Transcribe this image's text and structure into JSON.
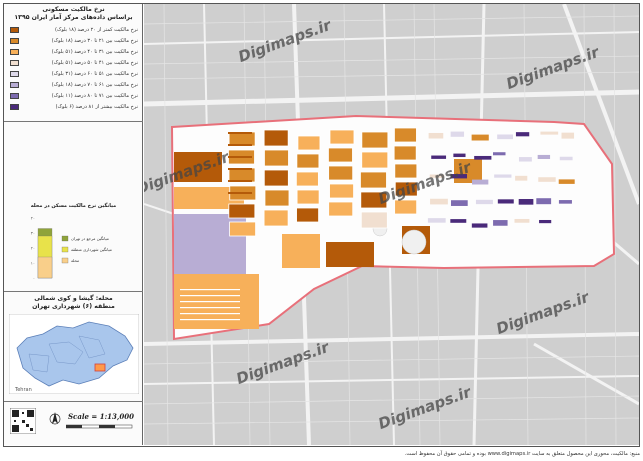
{
  "legend": {
    "title1": "نرخ مالکیت مسکونی",
    "title2": "براساس داده‌های مرکز آمار ایران ۱۳۹۵",
    "items": [
      {
        "label": "نرخ مالکیت کمتر از ۲۰ درصد (۱۸ بلوک)",
        "color": "#b45a09"
      },
      {
        "label": "نرخ مالکیت بین ۲۱ تا ۳۰ درصد (۱۸ بلوک)",
        "color": "#d88a2a"
      },
      {
        "label": "نرخ مالکیت بین ۳۱ تا ۴۰ درصد (۵۱ بلوک)",
        "color": "#f7b05a"
      },
      {
        "label": "نرخ مالکیت بین ۴۱ تا ۵۰ درصد (۵۱ بلوک)",
        "color": "#f1dfd0"
      },
      {
        "label": "نرخ مالکیت بین ۵۱ تا ۶۰ درصد (۳۱ بلوک)",
        "color": "#ded9ea"
      },
      {
        "label": "نرخ مالکیت بین ۶۱ تا ۷۰ درصد (۱۸ بلوک)",
        "color": "#b8add4"
      },
      {
        "label": "نرخ مالکیت بین ۷۱ تا ۸۰ درصد (۱۱ بلوک)",
        "color": "#7d6baf"
      },
      {
        "label": "نرخ مالکیت بیشتر از ۸۱ درصد (۶ بلوک)",
        "color": "#4a2a7a"
      }
    ],
    "chart_title": "میانگین نرخ مالکیت مسکن در محله",
    "chart_legend": [
      {
        "label": "میانگین مرجع در تهران",
        "color": "#8fa33a"
      },
      {
        "label": "میانگین شهرداری منطقه",
        "color": "#e8e24a"
      },
      {
        "label": "محله",
        "color": "#f9cf8a"
      }
    ],
    "chart_ticks": [
      "۴۰",
      "۳۰",
      "۲۰",
      "۱۰",
      "۰"
    ],
    "neighborhood_line1": "محله: گیشا و کوی شمالی",
    "neighborhood_line2": "منطقه (۶) شهرداری تهران",
    "scale": "Scale = 1:13,000",
    "map_label": "Tehran"
  },
  "map": {
    "watermark": "Digimaps.ir",
    "boundary_color": "#e8707a",
    "road_color": "#f4f4f4"
  },
  "chart_data": {
    "type": "bar",
    "title": "میانگین نرخ مالکیت مسکن در محله",
    "categories": [
      "میانگین مرجع در تهران",
      "میانگین شهرداری منطقه",
      "محله"
    ],
    "values": [
      33,
      28,
      14
    ],
    "ylim": [
      0,
      40
    ]
  },
  "footer": "منبع: مالکیت، محوری این محصول متعلق به سایت www.digimaps.ir بوده و تمامی حقوق آن محفوظ است."
}
